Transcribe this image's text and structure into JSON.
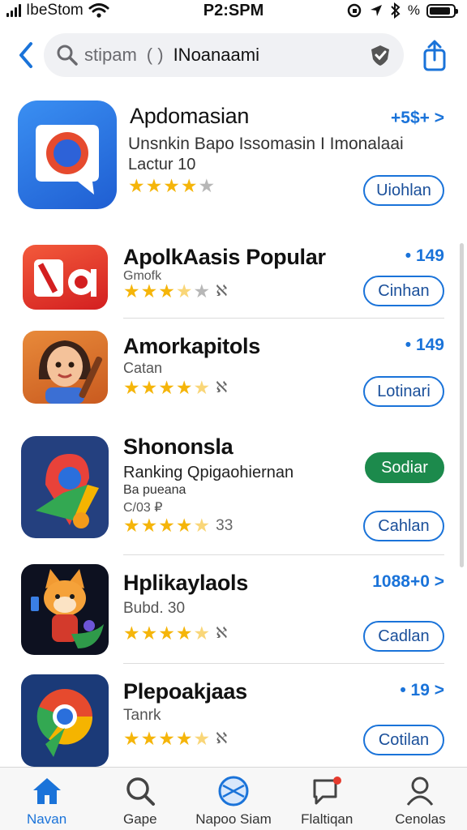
{
  "status_bar": {
    "carrier": "IbeStom",
    "time": "P2:SPM",
    "battery_level": 0.9,
    "battery_percent": "%"
  },
  "search": {
    "placeholder": "stipam",
    "parens": "( )",
    "value": "INoanaami"
  },
  "apps": [
    {
      "name": "Apdomasian",
      "subtitle": "Unsnkin Bapo Issomasin I Imonalaai",
      "subtitle2": "Lactur   10",
      "price": "+5$+ >",
      "rating": 4,
      "rating_count": "",
      "button": "Uiohlan",
      "button_primary": false
    },
    {
      "name": "ApolkAasis Popular",
      "subtitle": "Gmofk",
      "price": "• 149",
      "rating": 3.5,
      "rating_count": "ℵ",
      "button": "Cinhan",
      "button_primary": false
    },
    {
      "name": "Amorkapitols",
      "subtitle": "Catan",
      "price": "• 149",
      "rating": 4.5,
      "rating_count": "ℵ",
      "button": "Lotinari",
      "button_primary": false
    },
    {
      "name": "Shononsla",
      "subtitle": "Ranking Qpigaohiernan",
      "subtitle2": "Ba pueana",
      "subtitle3": "C/03 ₽",
      "price": "",
      "rating": 4.5,
      "rating_count": "33",
      "button": "Sodiar",
      "button_primary": true,
      "button2": "Cahlan"
    },
    {
      "name": "Hplikaylaols",
      "subtitle": "Bubd.   30",
      "price": "1088+0 >",
      "rating": 4.5,
      "rating_count": "ℵ",
      "button": "Cadlan",
      "button_primary": false
    },
    {
      "name": "Plepoakjaas",
      "subtitle": "Tanrk",
      "price": "• 19 >",
      "rating": 4.5,
      "rating_count": "ℵ",
      "button": "Cotilan",
      "button_primary": false
    }
  ],
  "tabs": [
    {
      "label": "Navan",
      "icon": "home-icon",
      "active": true
    },
    {
      "label": "Gape",
      "icon": "search-icon",
      "active": false
    },
    {
      "label": "Napoo Siam",
      "icon": "globe-icon",
      "active": false
    },
    {
      "label": "Flaltiqan",
      "icon": "notification-icon",
      "active": false
    },
    {
      "label": "Cenolas",
      "icon": "person-icon",
      "active": false
    }
  ],
  "colors": {
    "accent": "#1a73d9",
    "primary_button": "#1c8a4c",
    "star": "#f5b50a"
  }
}
